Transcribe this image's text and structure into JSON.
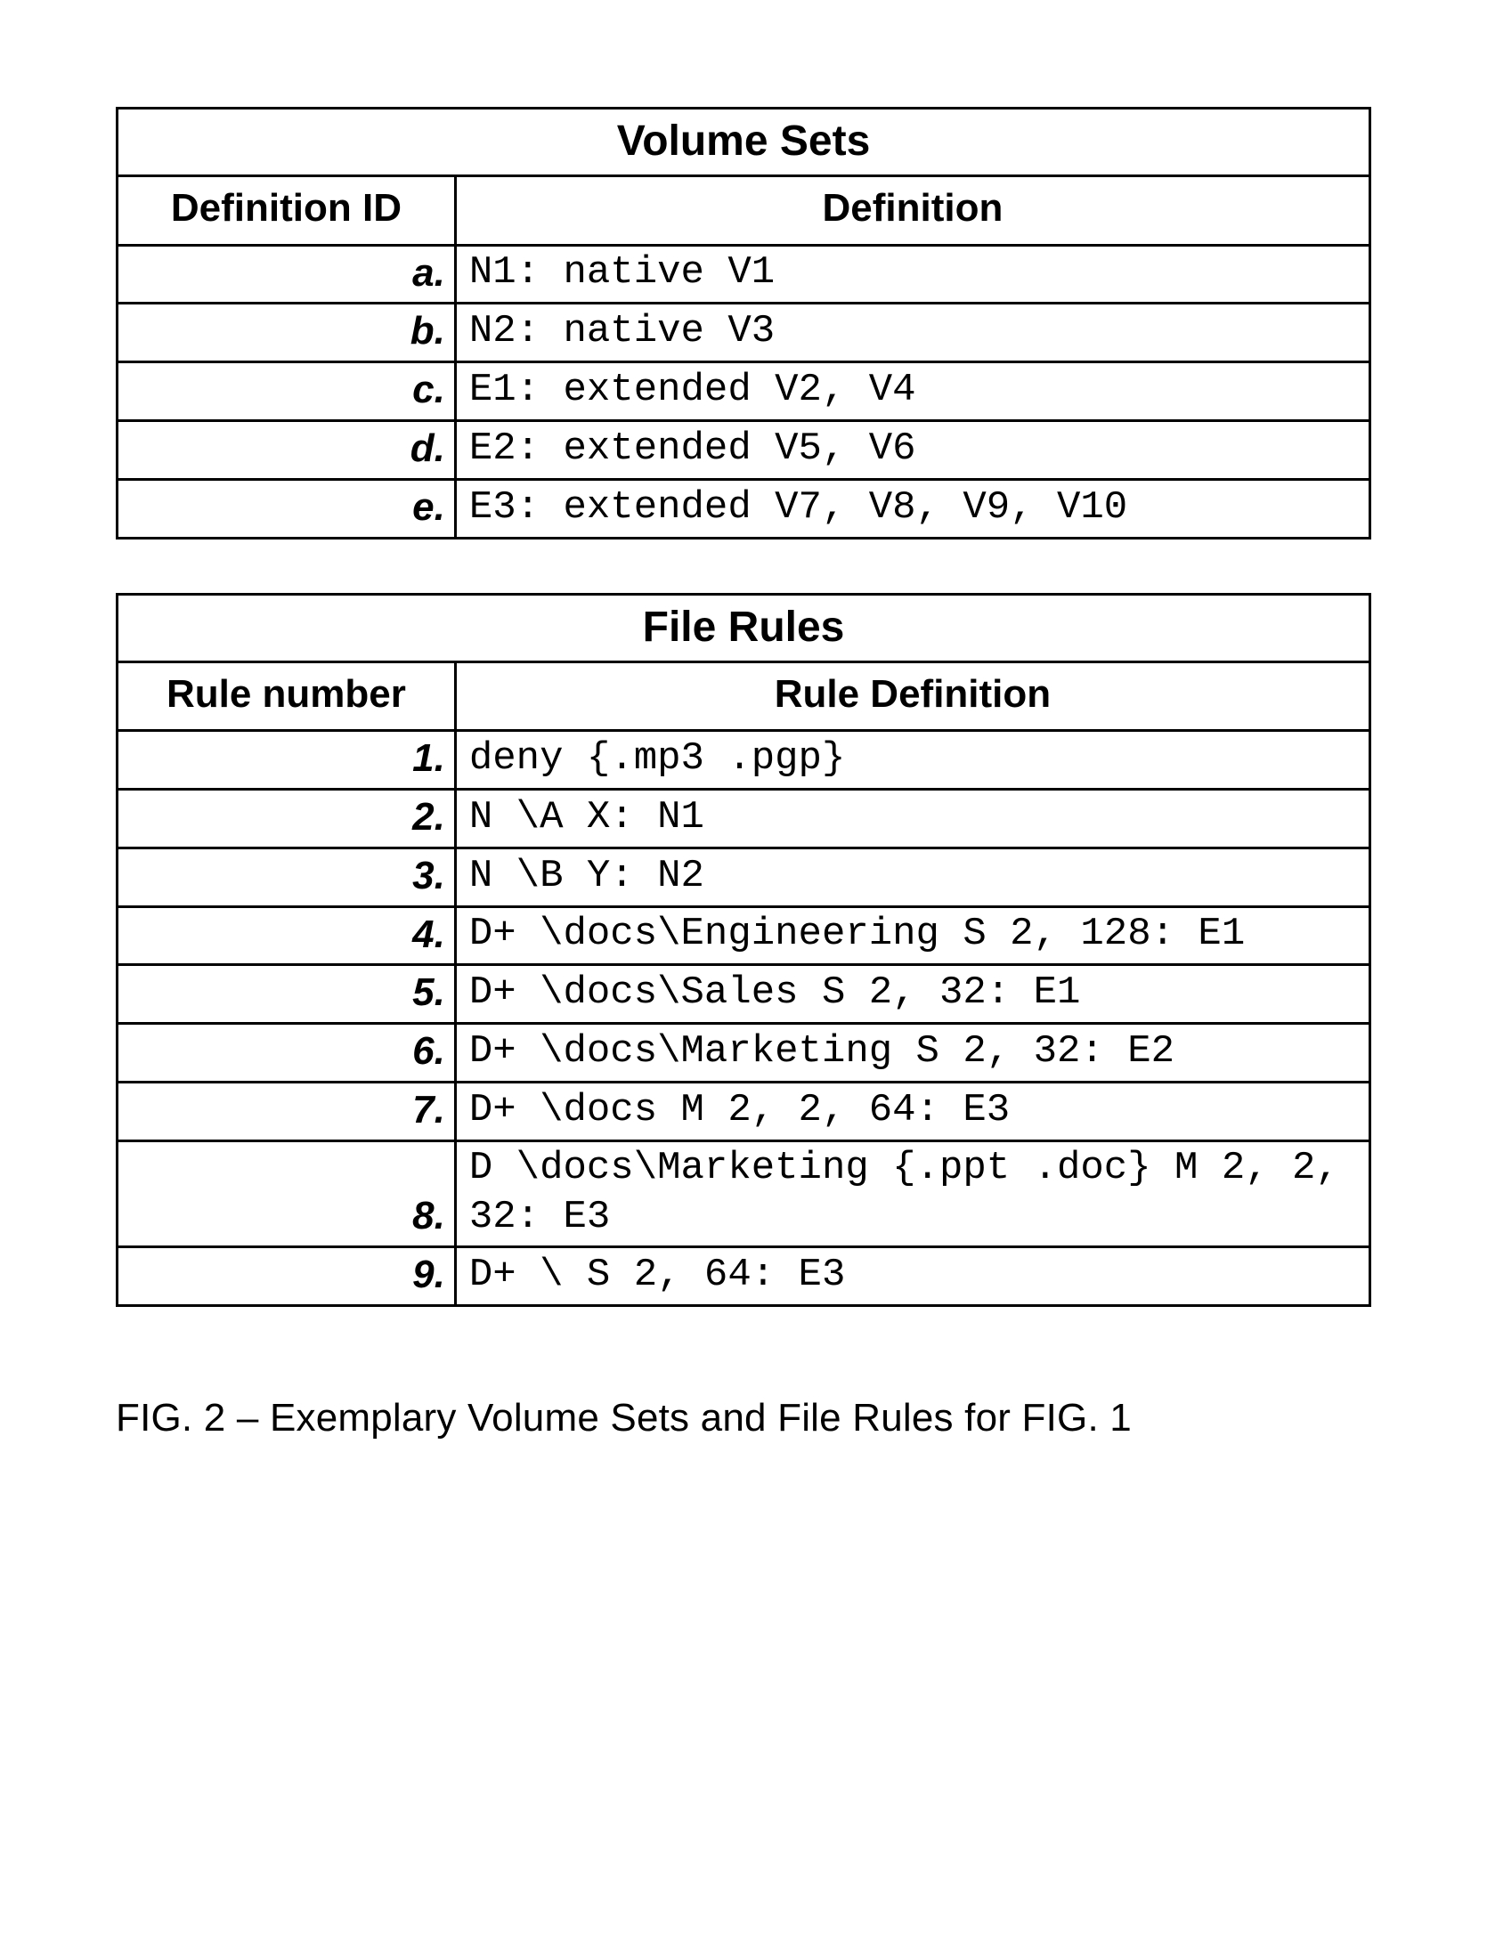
{
  "volume_sets": {
    "title": "Volume Sets",
    "col1_header": "Definition ID",
    "col2_header": "Definition",
    "rows": [
      {
        "id": "a.",
        "def": "N1: native V1"
      },
      {
        "id": "b.",
        "def": "N2: native V3"
      },
      {
        "id": "c.",
        "def": "E1: extended V2, V4"
      },
      {
        "id": "d.",
        "def": "E2: extended V5, V6"
      },
      {
        "id": "e.",
        "def": "E3: extended V7, V8, V9, V10"
      }
    ]
  },
  "file_rules": {
    "title": "File Rules",
    "col1_header": "Rule number",
    "col2_header": "Rule Definition",
    "rows": [
      {
        "id": "1.",
        "def": "deny {.mp3 .pgp}"
      },
      {
        "id": "2.",
        "def": "N \\A X: N1"
      },
      {
        "id": "3.",
        "def": "N \\B Y: N2"
      },
      {
        "id": "4.",
        "def": "D+ \\docs\\Engineering S 2, 128: E1"
      },
      {
        "id": "5.",
        "def": "D+ \\docs\\Sales S 2, 32: E1"
      },
      {
        "id": "6.",
        "def": "D+ \\docs\\Marketing S 2, 32: E2"
      },
      {
        "id": "7.",
        "def": "D+ \\docs M 2, 2, 64: E3"
      },
      {
        "id": "8.",
        "def": "D \\docs\\Marketing {.ppt .doc} M 2, 2, 32: E3"
      },
      {
        "id": "9.",
        "def": "D+ \\ S 2, 64: E3"
      }
    ]
  },
  "caption": "FIG. 2 – Exemplary Volume Sets and File Rules for FIG. 1"
}
